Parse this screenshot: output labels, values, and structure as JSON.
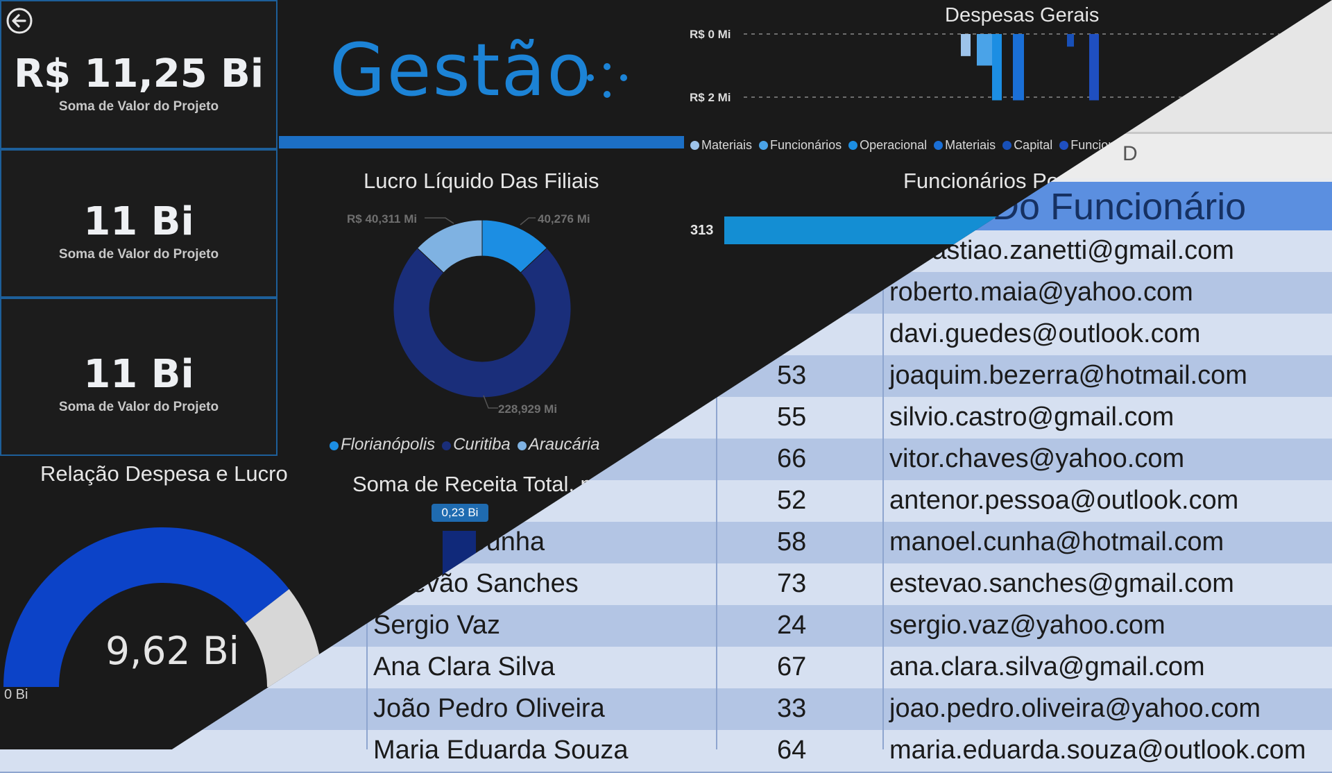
{
  "spreadsheet": {
    "column_letter": "D",
    "header": "Email Do Funcionário",
    "rows": [
      {
        "name": "",
        "age": "",
        "email": "sebastiao.zanetti@gmail.com"
      },
      {
        "name": "",
        "age": "",
        "email": "roberto.maia@yahoo.com"
      },
      {
        "name": "",
        "age": "",
        "email": "davi.guedes@outlook.com"
      },
      {
        "name": "",
        "age": "53",
        "email": "joaquim.bezerra@hotmail.com"
      },
      {
        "name": "",
        "age": "55",
        "email": "silvio.castro@gmail.com"
      },
      {
        "name": "",
        "age": "66",
        "email": "vitor.chaves@yahoo.com"
      },
      {
        "name": "",
        "age": "52",
        "email": "antenor.pessoa@outlook.com"
      },
      {
        "name": "Manoel Cunha",
        "age": "58",
        "email": "manoel.cunha@hotmail.com"
      },
      {
        "name": "Estevão Sanches",
        "age": "73",
        "email": "estevao.sanches@gmail.com"
      },
      {
        "name": "Sergio Vaz",
        "age": "24",
        "email": "sergio.vaz@yahoo.com"
      },
      {
        "name": "Ana Clara Silva",
        "age": "67",
        "email": "ana.clara.silva@gmail.com"
      },
      {
        "name": "João Pedro Oliveira",
        "age": "33",
        "email": "joao.pedro.oliveira@yahoo.com"
      },
      {
        "name": "Maria Eduarda Souza",
        "age": "64",
        "email": "maria.eduarda.souza@outlook.com"
      }
    ]
  },
  "dashboard": {
    "title": "Gestão",
    "back_icon": "arrow-left-circle-icon",
    "kpis": [
      {
        "value": "R$ 11,25 Bi",
        "label": "Soma de Valor do Projeto"
      },
      {
        "value": "11 Bi",
        "label": "Soma de Valor do Projeto"
      },
      {
        "value": "11 Bi",
        "label": "Soma de Valor do Projeto"
      }
    ],
    "despesas": {
      "title": "Despesas Gerais",
      "y_labels": [
        "R$ 0 Mi",
        "R$ 2 Mi"
      ],
      "legend": [
        "Materiais",
        "Funcionários",
        "Operacional",
        "Materiais",
        "Capital",
        "Funcionários"
      ],
      "legend_colors": [
        "#9dc3ea",
        "#4aa3e8",
        "#1c8ee3",
        "#1a6fd6",
        "#1850b8",
        "#1f4fc0"
      ]
    },
    "lucro": {
      "title": "Lucro Líquido Das Filiais",
      "labels": [
        "R$ 40,311 Mi",
        "40,276 Mi",
        "228,929 Mi"
      ],
      "legend": [
        "Florianópolis",
        "Curitiba",
        "Araucária"
      ],
      "legend_colors": [
        "#1c8ee3",
        "#1a2e7a",
        "#7fb2e2"
      ]
    },
    "funcionarios": {
      "title": "Funcionários Por",
      "bar_label": "313"
    },
    "receita": {
      "title": "Soma de Receita Total, por",
      "data_label": "0,23 Bi"
    },
    "gauge": {
      "title": "Relação Despesa e Lucro",
      "value": "9,62 Bi",
      "min_label": "0 Bi"
    }
  },
  "chart_data": [
    {
      "type": "bar",
      "title": "Despesas Gerais",
      "series": [
        {
          "name": "Materiais",
          "values": [
            0.7
          ]
        },
        {
          "name": "Funcionários",
          "values": [
            1.0
          ]
        },
        {
          "name": "Operacional",
          "values": [
            2.1
          ]
        },
        {
          "name": "Materiais",
          "values": [
            2.1
          ]
        },
        {
          "name": "Capital",
          "values": [
            0.4
          ]
        },
        {
          "name": "Funcionários",
          "values": [
            2.1
          ]
        }
      ],
      "ylim": [
        0,
        2
      ]
    },
    {
      "type": "pie",
      "title": "Lucro Líquido Das Filiais",
      "categories": [
        "Florianópolis",
        "Curitiba",
        "Araucária"
      ],
      "values": [
        40.276,
        228.929,
        40.311
      ]
    },
    {
      "type": "bar",
      "title": "Funcionários Por",
      "values": [
        313
      ]
    },
    {
      "type": "bar",
      "title": "Soma de Receita Total, por",
      "values": [
        0.23
      ]
    },
    {
      "type": "gauge",
      "title": "Relação Despesa e Lucro",
      "value": 9.62,
      "min": 0,
      "fill_fraction": 0.79
    }
  ]
}
